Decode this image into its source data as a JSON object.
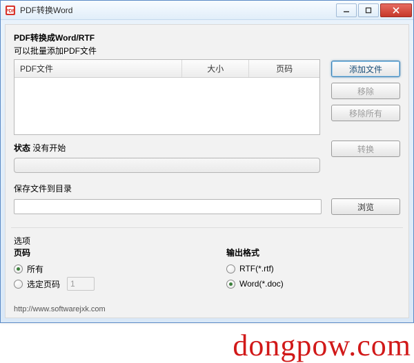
{
  "window": {
    "title": "PDF转换Word"
  },
  "heading": "PDF转换成Word/RTF",
  "subheading": "可以批量添加PDF文件",
  "table": {
    "columns": {
      "file": "PDF文件",
      "size": "大小",
      "pages": "页码"
    }
  },
  "buttons": {
    "add": "添加文件",
    "remove": "移除",
    "remove_all": "移除所有",
    "convert": "转换",
    "browse": "浏览"
  },
  "status": {
    "label": "状态",
    "value": "没有开始"
  },
  "save": {
    "label": "保存文件到目录",
    "path": ""
  },
  "options": {
    "section_label": "选项",
    "pages": {
      "label": "页码",
      "all": "所有",
      "selected": "选定页码",
      "selected_value": "1",
      "choice": "all"
    },
    "output": {
      "label": "输出格式",
      "rtf": "RTF(*.rtf)",
      "word": "Word(*.doc)",
      "choice": "word"
    }
  },
  "footer": {
    "url": "http://www.softwarejxk.com"
  },
  "watermark": "dongpow.com"
}
